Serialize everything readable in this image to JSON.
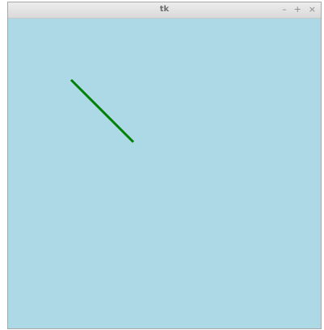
{
  "window": {
    "title": "tk",
    "controls": {
      "minimize": "–",
      "maximize": "+",
      "close": "×"
    }
  },
  "canvas": {
    "background": "#add8e6",
    "line": {
      "color": "#008000"
    }
  }
}
